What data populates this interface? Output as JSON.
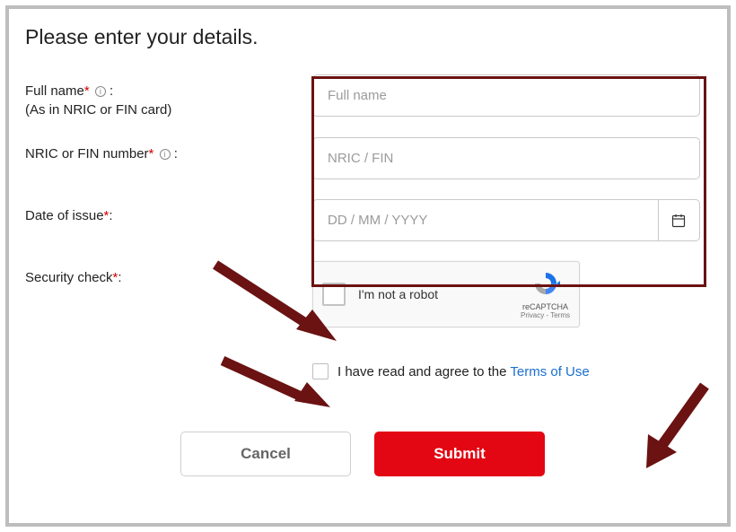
{
  "heading": "Please enter your details.",
  "fields": {
    "fullname": {
      "label": "Full name",
      "sublabel": "(As in NRIC or FIN card)",
      "placeholder": "Full name"
    },
    "nric": {
      "label": "NRIC or FIN number",
      "placeholder": "NRIC / FIN"
    },
    "doi": {
      "label": "Date of issue",
      "placeholder": "DD / MM / YYYY"
    },
    "security": {
      "label": "Security check"
    }
  },
  "colon": ":",
  "asterisk": "*",
  "info_glyph": "i",
  "recaptcha": {
    "text": "I'm not a robot",
    "brand": "reCAPTCHA",
    "privacy": "Privacy",
    "sep": " - ",
    "terms": "Terms"
  },
  "consent": {
    "prefix": "I have read and agree to the ",
    "link": "Terms of Use"
  },
  "buttons": {
    "cancel": "Cancel",
    "submit": "Submit"
  }
}
